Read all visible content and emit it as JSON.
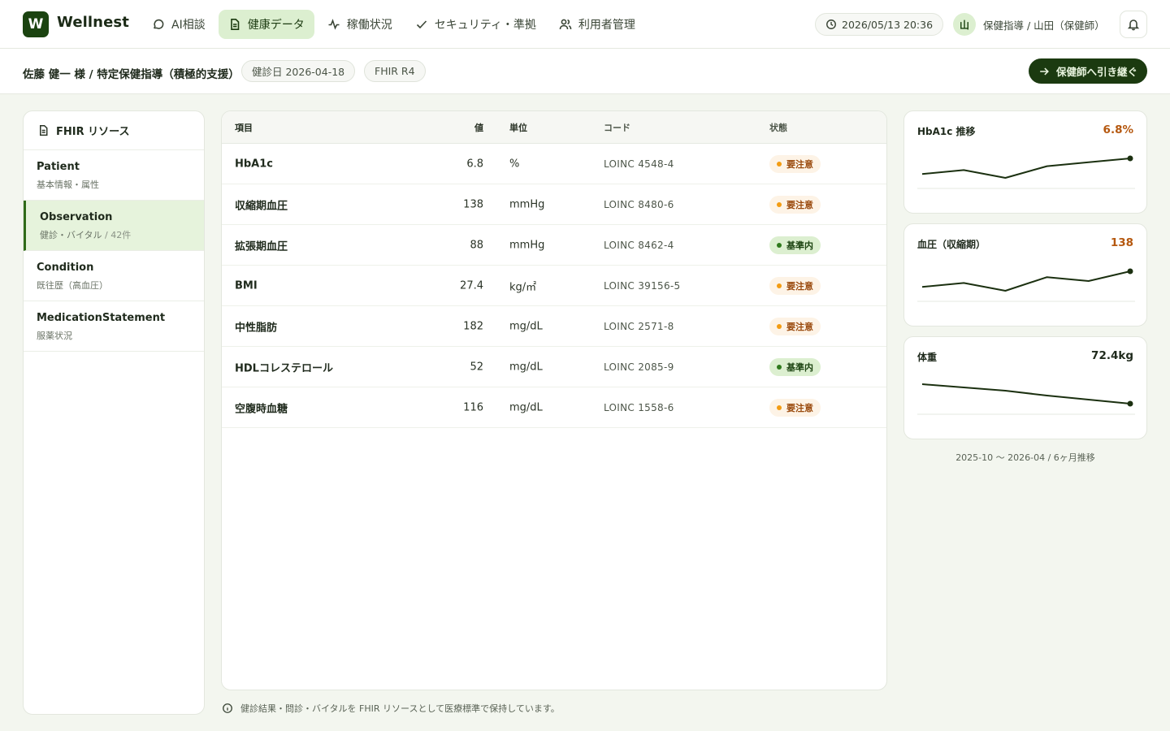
{
  "app": {
    "logo_letter": "W",
    "name": "Wellnest"
  },
  "nav": [
    {
      "label": "AI相談",
      "icon": "chat-icon",
      "active": false
    },
    {
      "label": "健康データ",
      "icon": "document-icon",
      "active": true
    },
    {
      "label": "稼働状況",
      "icon": "activity-icon",
      "active": false
    },
    {
      "label": "セキュリティ・準拠",
      "icon": "check-icon",
      "active": false
    },
    {
      "label": "利用者管理",
      "icon": "users-icon",
      "active": false
    }
  ],
  "header": {
    "datetime": "2026/05/13 20:36",
    "user_avatar": "山",
    "user_label": "保健指導 / 山田（保健師）"
  },
  "subheader": {
    "patient": "佐藤 健一 様 / 特定保健指導（積極的支援）",
    "exam_date": "健診日 2026-04-18",
    "fhir_version": "FHIR R4",
    "handoff_label": "保健師へ引き継ぐ"
  },
  "sidebar": {
    "title": "FHIR リソース",
    "items": [
      {
        "title": "Patient",
        "sub": "基本情報・属性",
        "count": ""
      },
      {
        "title": "Observation",
        "sub": "健診・バイタル",
        "count": " / 42件"
      },
      {
        "title": "Condition",
        "sub": "既往歴（高血圧）",
        "count": ""
      },
      {
        "title": "MedicationStatement",
        "sub": "服薬状況",
        "count": ""
      }
    ]
  },
  "table": {
    "headers": {
      "item": "項目",
      "value": "値",
      "unit": "単位",
      "code": "コード",
      "status": "状態"
    },
    "rows": [
      {
        "item": "HbA1c",
        "value": "6.8",
        "unit": "%",
        "code": "LOINC 4548-4",
        "status": "要注意",
        "level": "warn"
      },
      {
        "item": "収縮期血圧",
        "value": "138",
        "unit": "mmHg",
        "code": "LOINC 8480-6",
        "status": "要注意",
        "level": "warn"
      },
      {
        "item": "拡張期血圧",
        "value": "88",
        "unit": "mmHg",
        "code": "LOINC 8462-4",
        "status": "基準内",
        "level": "ok"
      },
      {
        "item": "BMI",
        "value": "27.4",
        "unit": "kg/㎡",
        "code": "LOINC 39156-5",
        "status": "要注意",
        "level": "warn"
      },
      {
        "item": "中性脂肪",
        "value": "182",
        "unit": "mg/dL",
        "code": "LOINC 2571-8",
        "status": "要注意",
        "level": "warn"
      },
      {
        "item": "HDLコレステロール",
        "value": "52",
        "unit": "mg/dL",
        "code": "LOINC 2085-9",
        "status": "基準内",
        "level": "ok"
      },
      {
        "item": "空腹時血糖",
        "value": "116",
        "unit": "mg/dL",
        "code": "LOINC 1558-6",
        "status": "要注意",
        "level": "warn"
      }
    ]
  },
  "footnote": "健診結果・問診・バイタルを FHIR リソースとして医療標準で保持しています。",
  "colors": {
    "brand": "#1b4310",
    "accent_bg": "#dcefd0",
    "warn": "#b5580f",
    "ok": "#1b4310",
    "line": "#1b3010"
  },
  "chart_data": [
    {
      "type": "line",
      "title": "HbA1c 推移",
      "current": "6.8%",
      "value_color": "#b5580f",
      "values": [
        6.4,
        6.5,
        6.3,
        6.6,
        6.7,
        6.8
      ]
    },
    {
      "type": "line",
      "title": "血圧（収縮期）",
      "current": "138",
      "value_color": "#b5580f",
      "values": [
        130,
        132,
        128,
        135,
        133,
        138
      ]
    },
    {
      "type": "line",
      "title": "体重",
      "current": "72.4kg",
      "value_color": "#1f2a1c",
      "values": [
        74.8,
        74.4,
        74.0,
        73.4,
        72.9,
        72.4
      ]
    }
  ],
  "trend_range": "2025-10 〜 2026-04 / 6ヶ月推移"
}
